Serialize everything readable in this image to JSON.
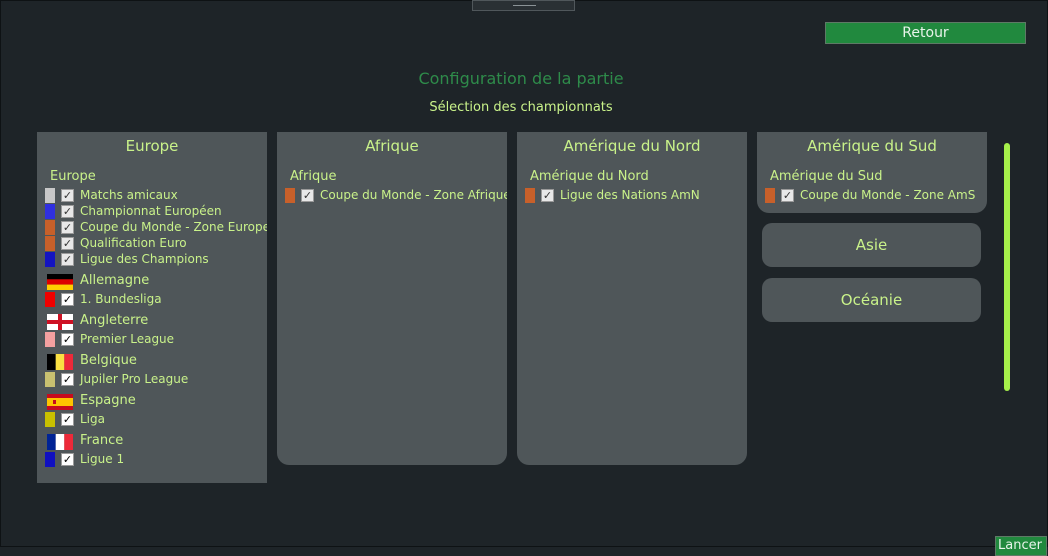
{
  "header": {
    "back_label": "Retour",
    "title": "Configuration de la partie",
    "subtitle": "Sélection des championnats",
    "launch_label": "Lancer"
  },
  "europe": {
    "title": "Europe",
    "region_label": "Europe",
    "competitions": [
      {
        "label": "Matchs amicaux",
        "color": "#c8c8c8"
      },
      {
        "label": "Championnat Européen",
        "color": "#3030e0"
      },
      {
        "label": "Coupe du Monde - Zone Europe",
        "color": "#c8602a"
      },
      {
        "label": "Qualification Euro",
        "color": "#c8602a"
      },
      {
        "label": "Ligue des Champions",
        "color": "#1414c0"
      }
    ],
    "countries": [
      {
        "name": "Allemagne",
        "league": "1. Bundesliga",
        "color": "#f00000"
      },
      {
        "name": "Angleterre",
        "league": "Premier League",
        "color": "#f4a0a0"
      },
      {
        "name": "Belgique",
        "league": "Jupiler Pro League",
        "color": "#c8c070"
      },
      {
        "name": "Espagne",
        "league": "Liga",
        "color": "#c8c000"
      },
      {
        "name": "France",
        "league": "Ligue 1",
        "color": "#1010c0"
      }
    ]
  },
  "afrique": {
    "title": "Afrique",
    "region_label": "Afrique",
    "competition": {
      "label": "Coupe du Monde - Zone Afrique",
      "color": "#c8602a"
    }
  },
  "amerique_nord": {
    "title": "Amérique du Nord",
    "region_label": "Amérique du Nord",
    "competition": {
      "label": "Ligue des Nations AmN",
      "color": "#c8602a"
    }
  },
  "amerique_sud": {
    "title": "Amérique du Sud",
    "region_label": "Amérique du Sud",
    "competition": {
      "label": "Coupe du Monde - Zone AmS",
      "color": "#c8602a"
    }
  },
  "continent_buttons": {
    "asie": "Asie",
    "oceanie": "Océanie"
  },
  "checkmark": "✓"
}
